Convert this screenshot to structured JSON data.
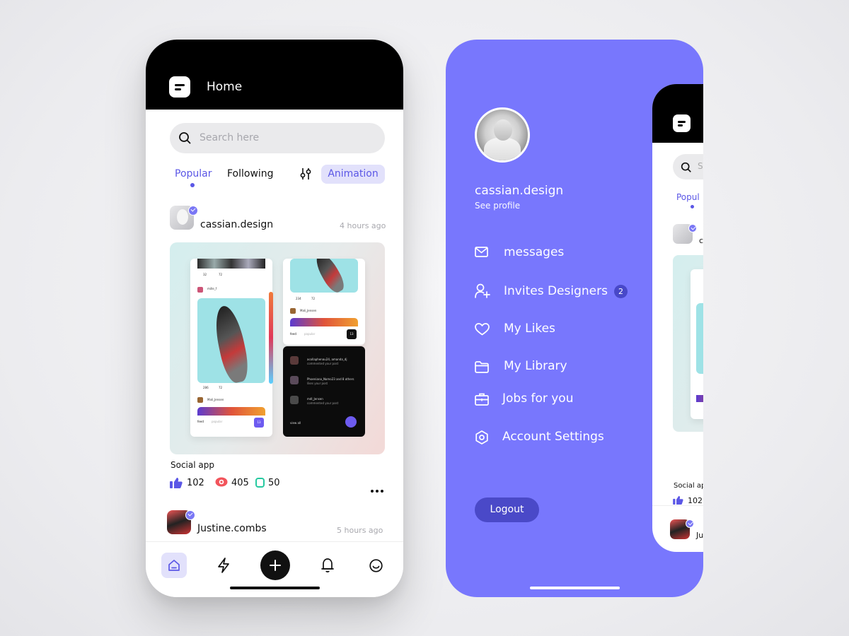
{
  "home": {
    "title": "Home",
    "search_placeholder": "Search here",
    "tabs": {
      "popular": "Popular",
      "following": "Following"
    },
    "chip": "Animation",
    "posts": [
      {
        "author": "cassian.design",
        "time": "4 hours ago",
        "caption": "Social app",
        "likes": "102",
        "views": "405",
        "comments": "50"
      },
      {
        "author": "Justine.combs",
        "time": "5 hours ago"
      }
    ],
    "mini": {
      "card1": {
        "s1": "32",
        "s2": "72",
        "user": "mille_f",
        "s3": "286",
        "s4": "72",
        "user2": "Mali_Jensen",
        "tab1": "feed",
        "tab2": "popular",
        "btn": "13"
      },
      "card2": {
        "s1": "234",
        "s2": "72",
        "user": "Mali_Jensen",
        "tab1": "feed",
        "tab2": "popular",
        "btn": "13"
      },
      "notif": [
        {
          "title": "acollaphenau24, amanda_dj",
          "sub": "commented your post"
        },
        {
          "title": "Phoeniana_Nomo23 and 8 others",
          "sub": "likes your post"
        },
        {
          "title": "mdl_Jensen",
          "sub": "commented your post"
        }
      ],
      "view_all": "view all"
    }
  },
  "menu": {
    "profile_name": "cassian.design",
    "profile_link": "See profile",
    "items": [
      {
        "label": "messages",
        "icon": "mail-icon"
      },
      {
        "label": "Invites Designers",
        "icon": "add-user-icon",
        "badge": "2"
      },
      {
        "label": "My Likes",
        "icon": "heart-icon"
      },
      {
        "label": "My Library",
        "icon": "folder-icon"
      },
      {
        "label": "Jobs for you",
        "icon": "briefcase-icon"
      },
      {
        "label": "Account Settings",
        "icon": "settings-icon"
      }
    ],
    "logout": "Logout",
    "preview": {
      "tab": "Popul",
      "caption": "Social ap",
      "likes": "102",
      "author_fragment": "c",
      "author2_fragment": "Ju",
      "search_fragment": "S"
    }
  },
  "colors": {
    "accent": "#5b57e6",
    "menu_bg": "#7877fd",
    "logout_bg": "#4a49c8",
    "chip_bg": "#e2e1fb"
  }
}
